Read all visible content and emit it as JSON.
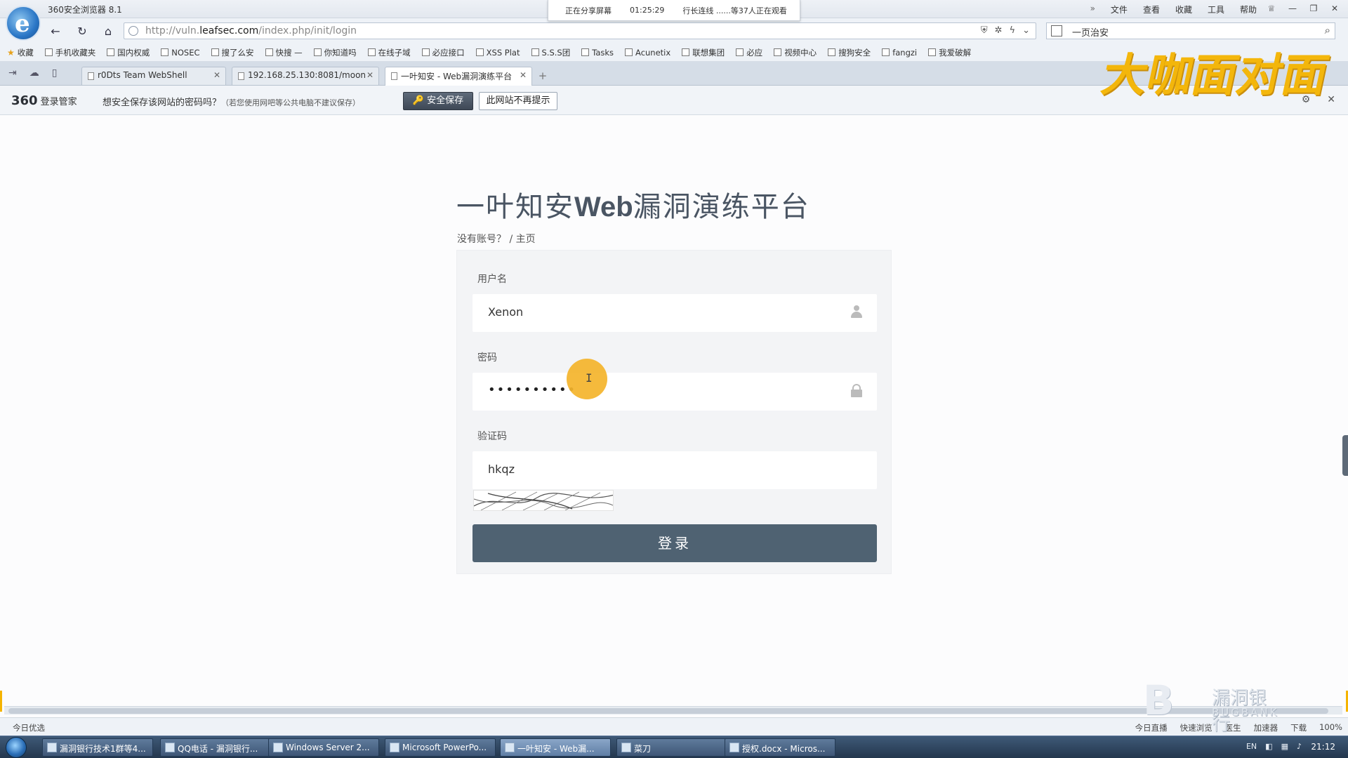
{
  "window": {
    "title": "360安全浏览器 8.1",
    "menu": [
      "文件",
      "查看",
      "收藏",
      "工具",
      "帮助"
    ],
    "controls": [
      "—",
      "❐",
      "✕"
    ]
  },
  "share_banner": {
    "status": "正在分享屏幕",
    "time": "01:25:29",
    "host": "行长连线 ......等37人正在观看"
  },
  "address_bar": {
    "url_prefix": "http://vuln.",
    "url_domain": "leafsec.com",
    "url_path": "/index.php/init/login",
    "search_text": "一页治安"
  },
  "favorites": [
    {
      "label": "收藏",
      "icon": "star-icon"
    },
    {
      "label": "手机收藏夹",
      "icon": "phone-icon"
    },
    {
      "label": "国内权威",
      "icon": "page-icon"
    },
    {
      "label": "NOSEC",
      "icon": "page-icon"
    },
    {
      "label": "搜了么安",
      "icon": "page-icon"
    },
    {
      "label": "快搜 —",
      "icon": "page-icon"
    },
    {
      "label": "你知道吗",
      "icon": "page-icon"
    },
    {
      "label": "在线子域",
      "icon": "page-icon"
    },
    {
      "label": "必应接口",
      "icon": "page-icon"
    },
    {
      "label": "XSS Plat",
      "icon": "page-icon"
    },
    {
      "label": "S.S.S团",
      "icon": "page-icon"
    },
    {
      "label": "Tasks",
      "icon": "search-icon"
    },
    {
      "label": "Acunetix",
      "icon": "page-icon"
    },
    {
      "label": "联想集团",
      "icon": "page-icon"
    },
    {
      "label": "必应",
      "icon": "page-icon"
    },
    {
      "label": "视频中心",
      "icon": "page-icon"
    },
    {
      "label": "搜狗安全",
      "icon": "page-icon"
    },
    {
      "label": "fangzi",
      "icon": "page-icon"
    },
    {
      "label": "我爱破解",
      "icon": "page-icon"
    }
  ],
  "tabs": [
    {
      "label": "r0Dts Team WebShell"
    },
    {
      "label": "192.168.25.130:8081/moon"
    },
    {
      "label": "一叶知安 - Web漏洞演练平台"
    }
  ],
  "password_bar": {
    "brand_num": "360",
    "brand_text": "登录管家",
    "question": "想安全保存该网站的密码吗？",
    "hint": "（若您使用网吧等公共电脑不建议保存）",
    "save_label": "安全保存",
    "never_label": "此网站不再提示"
  },
  "watermark": {
    "text": "大咖面对面",
    "bug_cn": "漏洞银行",
    "bug_en": "BUGBANK"
  },
  "login": {
    "title_cn_a": "一叶知安",
    "title_en": "Web",
    "title_cn_b": "漏洞演练平台",
    "no_account": "没有账号？",
    "separator": " / ",
    "home": "主页",
    "username_label": "用户名",
    "username_value": "Xenon",
    "password_label": "密码",
    "password_value": "••••••••••",
    "captcha_label": "验证码",
    "captcha_value": "hkqz",
    "submit_label": "登录"
  },
  "statusbar": {
    "left": "今日优选",
    "right": [
      "今日直播",
      "快速浏览",
      "医生",
      "加速器",
      "下载",
      "100%"
    ]
  },
  "taskbar": {
    "items": [
      "漏洞银行技术1群等4...",
      "QQ电话 - 漏洞银行...",
      "Windows Server 2...",
      "Microsoft PowerPo...",
      "一叶知安 - Web漏...",
      "菜刀",
      "授权.docx - Micros..."
    ],
    "tray": [
      "EN",
      "◧",
      "▦",
      "♪"
    ],
    "clock": "21:12"
  },
  "colors": {
    "accent": "#4f6272",
    "watermark": "#f5b400",
    "cursor": "#f5b52c"
  }
}
